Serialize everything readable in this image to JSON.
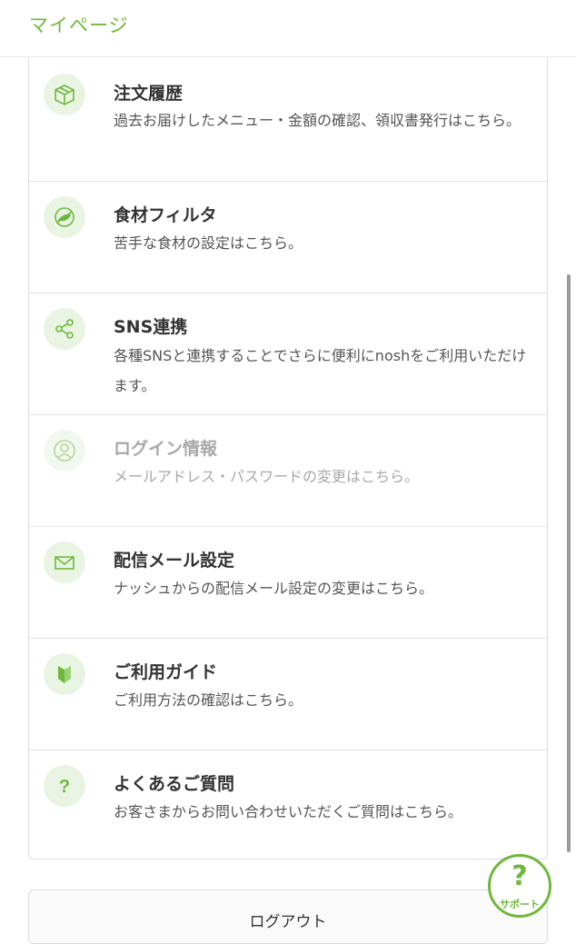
{
  "header": {
    "title": "マイページ"
  },
  "menu": [
    {
      "title": "注文履歴",
      "desc": "過去お届けしたメニュー・金額の確認、領収書発行はこちら。",
      "icon": "package-icon"
    },
    {
      "title": "食材フィルタ",
      "desc": "苦手な食材の設定はこちら。",
      "icon": "food-filter-icon"
    },
    {
      "title": "SNS連携",
      "desc": "各種SNSと連携することでさらに便利にnoshをご利用いただけます。",
      "icon": "share-icon"
    },
    {
      "title": "ログイン情報",
      "desc": "メールアドレス・パスワードの変更はこちら。",
      "icon": "user-icon"
    },
    {
      "title": "配信メール設定",
      "desc": "ナッシュからの配信メール設定の変更はこちら。",
      "icon": "mail-icon"
    },
    {
      "title": "ご利用ガイド",
      "desc": "ご利用方法の確認はこちら。",
      "icon": "beginner-mark-icon"
    },
    {
      "title": "よくあるご質問",
      "desc": "お客さまからお問い合わせいただくご質問はこちら。",
      "icon": "question-icon"
    }
  ],
  "logout": {
    "label": "ログアウト"
  },
  "support": {
    "symbol": "?",
    "label": "サポート"
  },
  "colors": {
    "accent": "#6eb93c",
    "icon_bg": "#e9f4e3"
  }
}
